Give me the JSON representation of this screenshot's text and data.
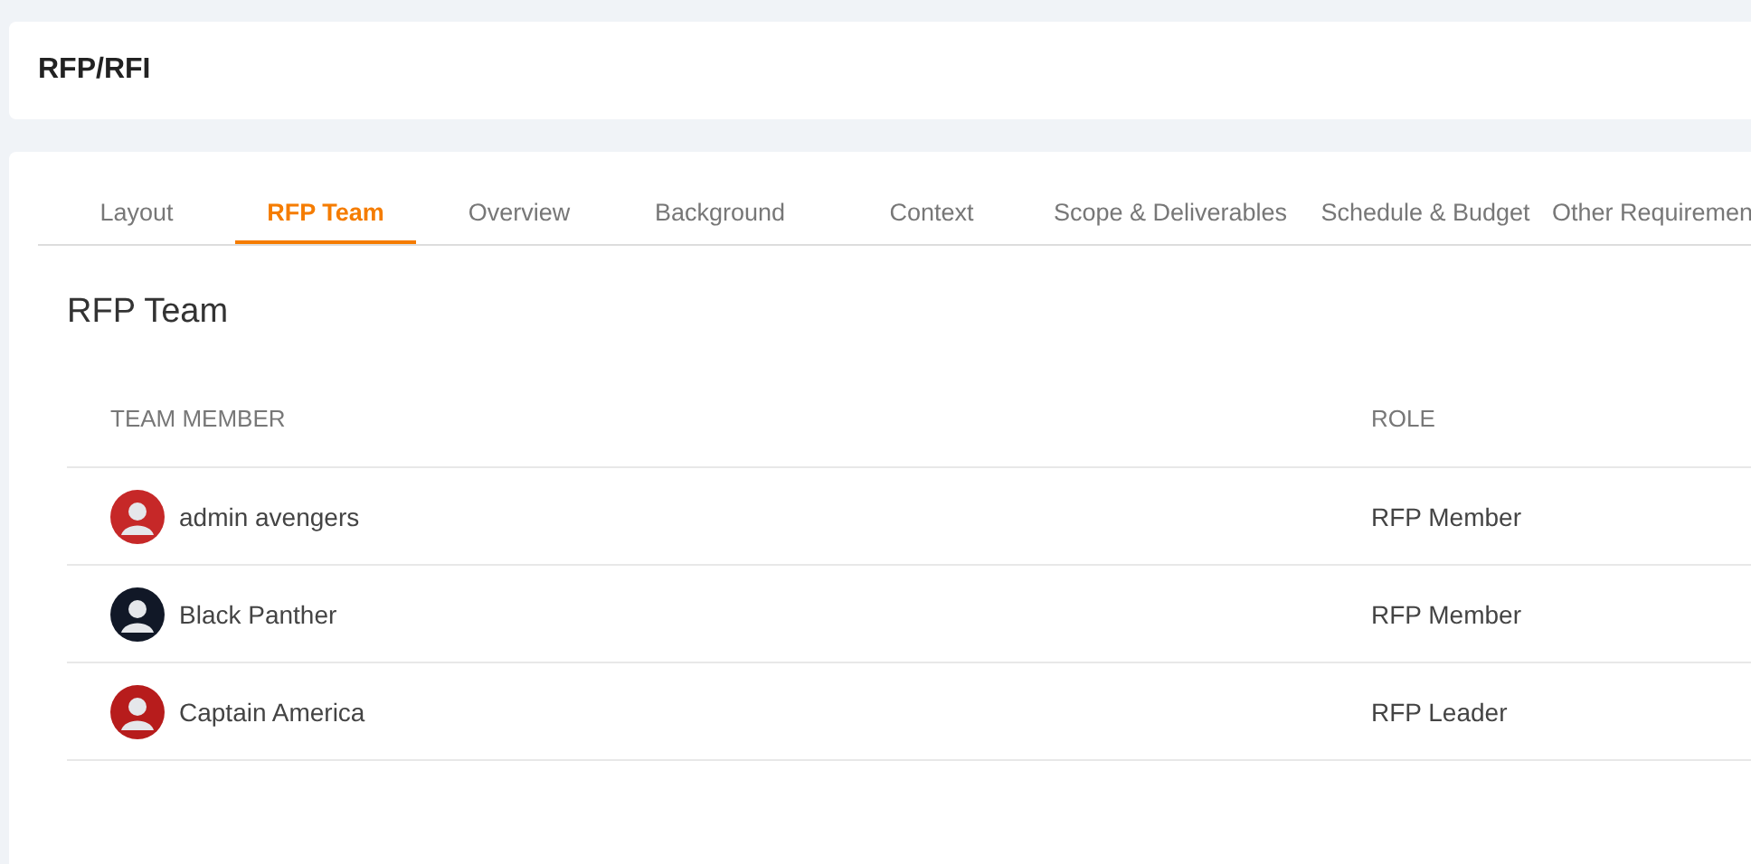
{
  "header": {
    "title": "RFP/RFI"
  },
  "tabs": [
    {
      "label": "Layout",
      "selected": false
    },
    {
      "label": "RFP Team",
      "selected": true
    },
    {
      "label": "Overview",
      "selected": false
    },
    {
      "label": "Background",
      "selected": false
    },
    {
      "label": "Context",
      "selected": false
    },
    {
      "label": "Scope & Deliverables",
      "selected": false
    },
    {
      "label": "Schedule & Budget",
      "selected": false
    },
    {
      "label": "Other Requiremen",
      "selected": false
    }
  ],
  "section": {
    "title": "RFP Team"
  },
  "table": {
    "columns": [
      "TEAM MEMBER",
      "ROLE"
    ],
    "rows": [
      {
        "name": "admin avengers",
        "role": "RFP Member",
        "color": "#c62828"
      },
      {
        "name": "Black Panther",
        "role": "RFP Member",
        "color": "#111827"
      },
      {
        "name": "Captain America",
        "role": "RFP Leader",
        "color": "#b71c1c"
      }
    ]
  }
}
